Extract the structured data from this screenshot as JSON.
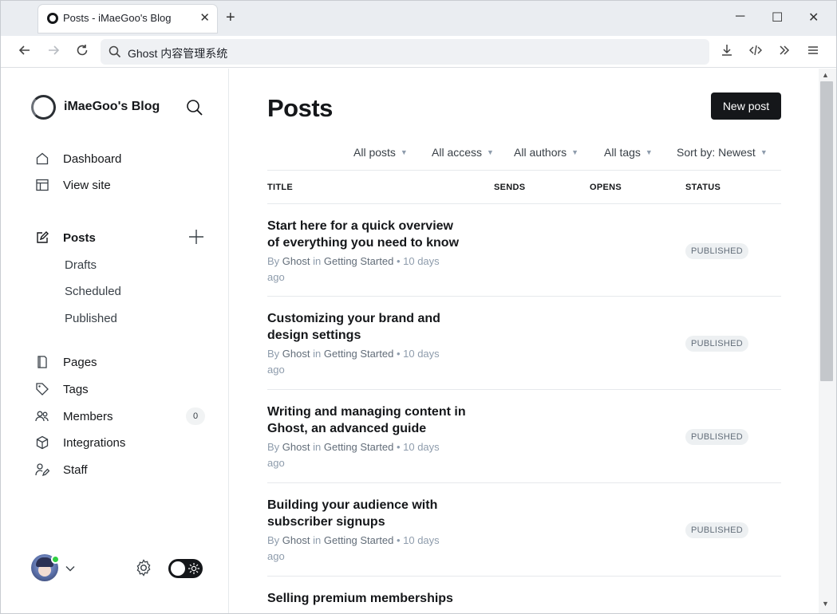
{
  "browser": {
    "tab_title": "Posts - iMaeGoo's Blog",
    "tab_close": "✕",
    "new_tab": "+",
    "url": "Ghost 内容管理系统",
    "minimize": "─",
    "maximize": "☐",
    "close": "✕"
  },
  "sidebar": {
    "brand": "iMaeGoo's Blog",
    "nav_top": [
      {
        "label": "Dashboard",
        "icon": "home-icon"
      },
      {
        "label": "View site",
        "icon": "layout-icon"
      }
    ],
    "posts": {
      "label": "Posts",
      "icon": "edit-icon"
    },
    "post_sub": [
      "Drafts",
      "Scheduled",
      "Published"
    ],
    "nav_bottom": [
      {
        "label": "Pages",
        "icon": "page-icon"
      },
      {
        "label": "Tags",
        "icon": "tag-icon"
      },
      {
        "label": "Members",
        "icon": "members-icon"
      },
      {
        "label": "Integrations",
        "icon": "cube-icon"
      },
      {
        "label": "Staff",
        "icon": "staff-icon"
      }
    ],
    "members_count": "0"
  },
  "main": {
    "title": "Posts",
    "new_post": "New post",
    "filters": [
      "All posts",
      "All access",
      "All authors",
      "All tags",
      "Sort by: Newest"
    ],
    "columns": [
      "TITLE",
      "SENDS",
      "OPENS",
      "STATUS"
    ],
    "meta_by": "By",
    "meta_in": "in",
    "meta_sep": "•",
    "posts": [
      {
        "title": "Start here for a quick overview of everything you need to know",
        "author": "Ghost",
        "tag": "Getting Started",
        "time": "10 days ago",
        "status": "PUBLISHED"
      },
      {
        "title": "Customizing your brand and design settings",
        "author": "Ghost",
        "tag": "Getting Started",
        "time": "10 days ago",
        "status": "PUBLISHED"
      },
      {
        "title": "Writing and managing content in Ghost, an advanced guide",
        "author": "Ghost",
        "tag": "Getting Started",
        "time": "10 days ago",
        "status": "PUBLISHED"
      },
      {
        "title": "Building your audience with subscriber signups",
        "author": "Ghost",
        "tag": "Getting Started",
        "time": "10 days ago",
        "status": "PUBLISHED"
      },
      {
        "title": "Selling premium memberships",
        "author": "",
        "tag": "",
        "time": "",
        "status": ""
      }
    ]
  },
  "colors": {
    "accent": "#15171a",
    "online": "#30cf43",
    "muted": "#8e9cac"
  }
}
